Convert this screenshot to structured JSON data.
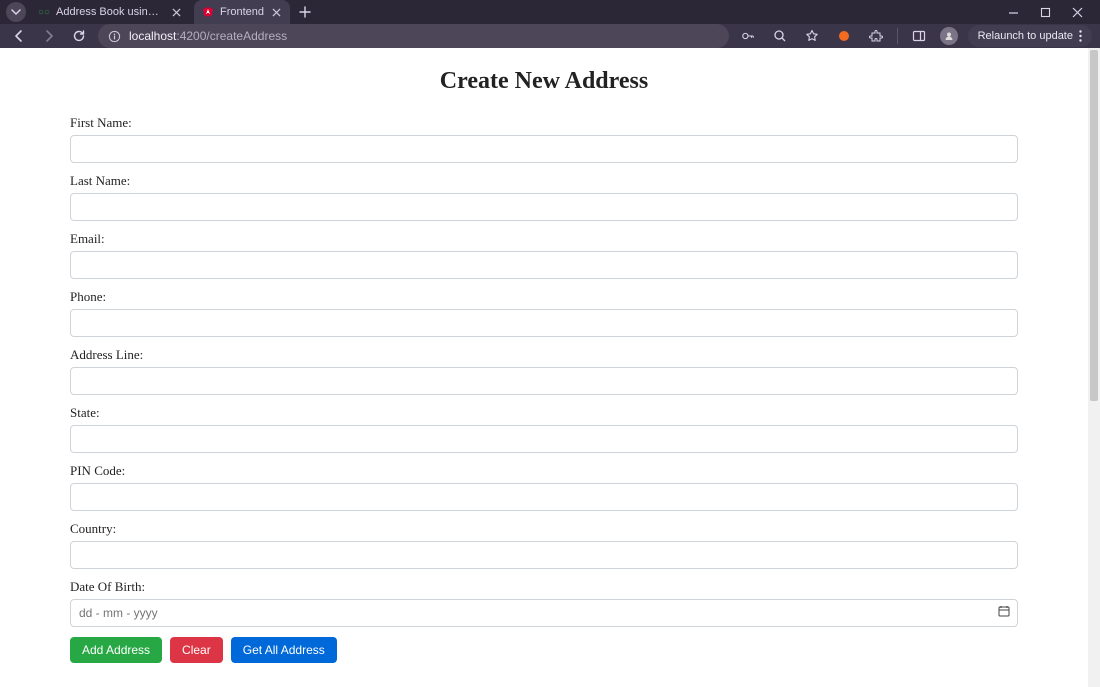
{
  "window": {
    "tabs": [
      {
        "title": "Address Book using MEAN - W",
        "active": false
      },
      {
        "title": "Frontend",
        "active": true
      }
    ],
    "relaunch_label": "Relaunch to update"
  },
  "addressbar": {
    "host": "localhost",
    "port": ":4200",
    "path": "/createAddress"
  },
  "page": {
    "title": "Create New Address",
    "fields": {
      "first_name": {
        "label": "First Name:",
        "value": ""
      },
      "last_name": {
        "label": "Last Name:",
        "value": ""
      },
      "email": {
        "label": "Email:",
        "value": ""
      },
      "phone": {
        "label": "Phone:",
        "value": ""
      },
      "address_line": {
        "label": "Address Line:",
        "value": ""
      },
      "state": {
        "label": "State:",
        "value": ""
      },
      "pin_code": {
        "label": "PIN Code:",
        "value": ""
      },
      "country": {
        "label": "Country:",
        "value": ""
      },
      "dob": {
        "label": "Date Of Birth:",
        "placeholder": "dd - mm - yyyy",
        "value": ""
      }
    },
    "buttons": {
      "add": "Add Address",
      "clear": "Clear",
      "get_all": "Get All Address"
    }
  }
}
